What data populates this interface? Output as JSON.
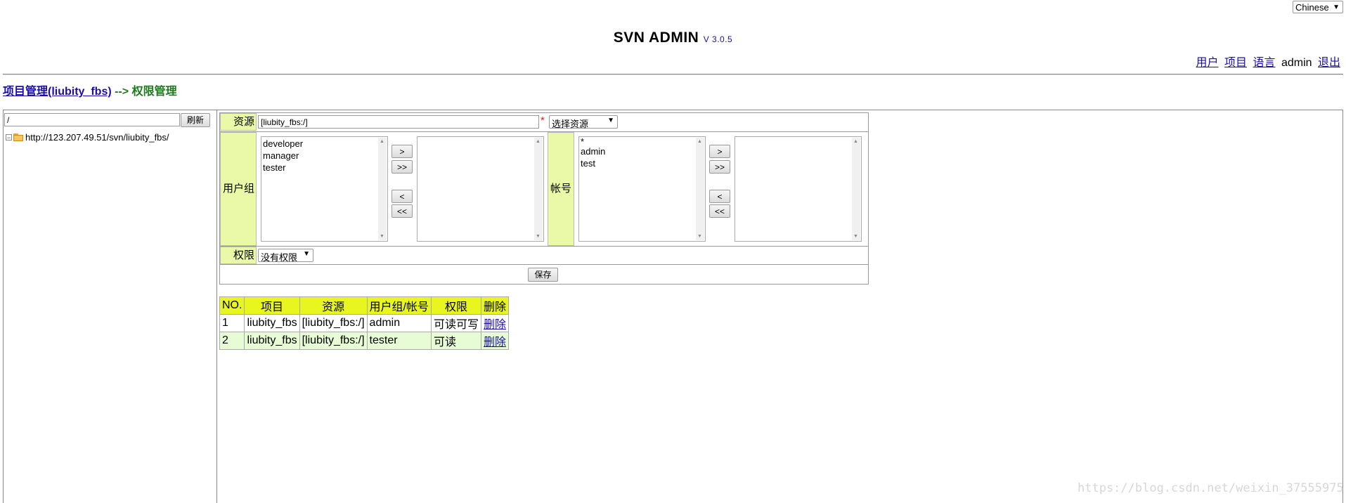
{
  "language_select": {
    "value": "Chinese"
  },
  "header": {
    "title": "SVN ADMIN",
    "version": "V 3.0.5"
  },
  "topnav": {
    "users": "用户",
    "projects": "项目",
    "language": "语言",
    "username": "admin",
    "logout": "退出"
  },
  "breadcrumb": {
    "project_link": "项目管理(liubity_fbs)",
    "separator": "-->",
    "current": "权限管理"
  },
  "left_panel": {
    "path_value": "/",
    "refresh_label": "刷新",
    "tree_root": "http://123.207.49.51/svn/liubity_fbs/"
  },
  "form": {
    "resource_label": "资源",
    "resource_value": "[liubity_fbs:/]",
    "required_mark": "*",
    "resource_select": "选择资源",
    "group_label": "用户组",
    "groups_available": [
      "developer",
      "manager",
      "tester"
    ],
    "account_label": "帐号",
    "accounts_available": [
      "*",
      "admin",
      "test"
    ],
    "move_buttons": {
      "add": ">",
      "add_all": ">>",
      "remove": "<",
      "remove_all": "<<"
    },
    "permission_label": "权限",
    "permission_value": "没有权限",
    "save_label": "保存"
  },
  "table": {
    "headers": [
      "NO.",
      "项目",
      "资源",
      "用户组/帐号",
      "权限",
      "删除"
    ],
    "rows": [
      {
        "no": "1",
        "project": "liubity_fbs",
        "resource": "[liubity_fbs:/]",
        "who": "admin",
        "perm": "可读可写",
        "del": "删除"
      },
      {
        "no": "2",
        "project": "liubity_fbs",
        "resource": "[liubity_fbs:/]",
        "who": "tester",
        "perm": "可读",
        "del": "删除"
      }
    ]
  },
  "watermark": "https://blog.csdn.net/weixin_37555975"
}
